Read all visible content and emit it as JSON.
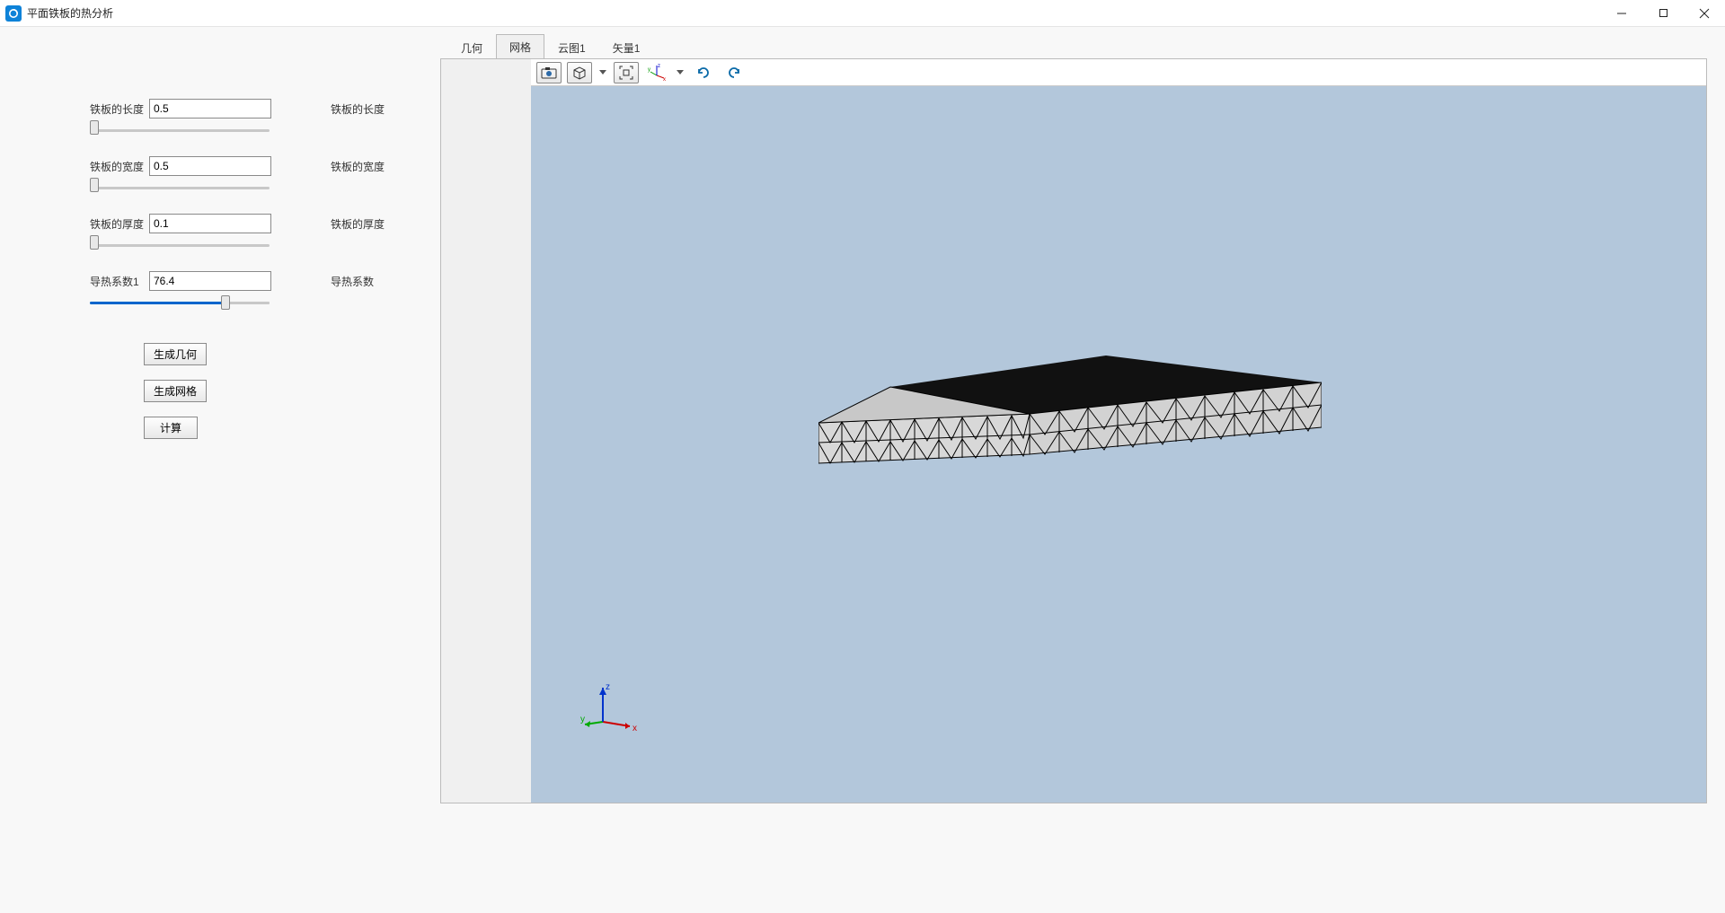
{
  "window": {
    "title": "平面铁板的热分析"
  },
  "params": {
    "length": {
      "label": "铁板的长度",
      "value": "0.5",
      "desc": "铁板的长度",
      "slider_pct": 0
    },
    "width": {
      "label": "铁板的宽度",
      "value": "0.5",
      "desc": "铁板的宽度",
      "slider_pct": 0
    },
    "thick": {
      "label": "铁板的厚度",
      "value": "0.1",
      "desc": "铁板的厚度",
      "slider_pct": 0
    },
    "cond": {
      "label": "导热系数1",
      "value": "76.4",
      "desc": "导热系数",
      "slider_pct": 77
    }
  },
  "buttons": {
    "gen_geom": "生成几何",
    "gen_mesh": "生成网格",
    "compute": "计算"
  },
  "tabs": {
    "geom": "几何",
    "mesh": "网格",
    "cloud1": "云图1",
    "vec1": "矢量1",
    "active": "mesh"
  },
  "axis": {
    "x": "x",
    "y": "y",
    "z": "z"
  }
}
